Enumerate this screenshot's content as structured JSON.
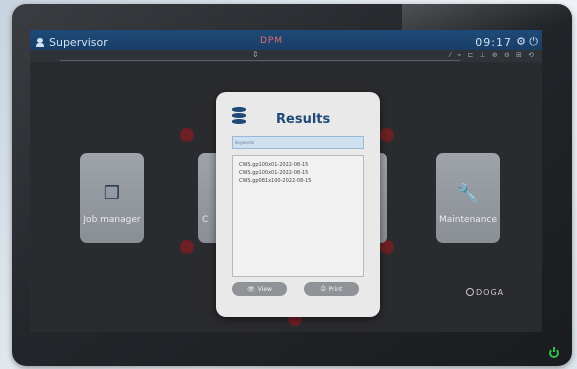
{
  "topbar": {
    "user_label": "Supervisor",
    "center_label": "DPM",
    "time": "09:17",
    "settings_icon": "gear-icon",
    "power_icon": "power-icon"
  },
  "subbar": {
    "toolbar_icons": "⁄ ⌁ ⊏ ⊥ ⊕ ⊖ ⊞ ⟲"
  },
  "tiles": [
    {
      "label": "Job manager",
      "icon": "boxes-icon"
    },
    {
      "label": "C",
      "icon": ""
    },
    {
      "label": "Maintenance",
      "icon": "wrench-icon"
    }
  ],
  "modal": {
    "title": "Results",
    "search_placeholder": "Keywords",
    "items": [
      "CWS.gp100x01-2022-08-15",
      "CWS.gp100x01-2022-08-15",
      "CWS.gp081x100-2022-08-15"
    ],
    "view_label": "View",
    "print_label": "Print"
  },
  "brand": "DOGA",
  "colors": {
    "accent": "#1f4a78",
    "topbar": "#163a5f",
    "power_led": "#2ec14a"
  }
}
